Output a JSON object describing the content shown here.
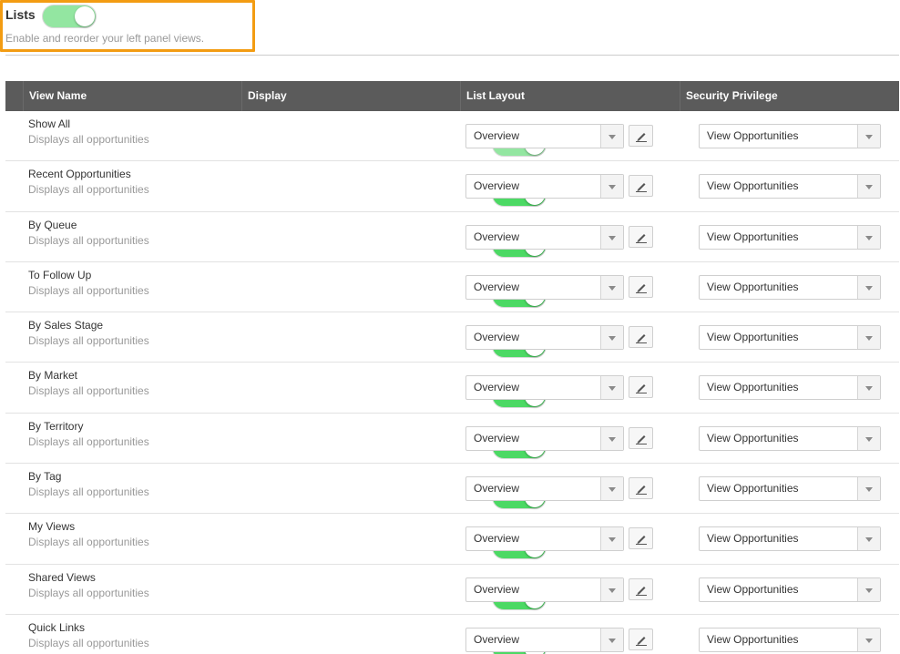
{
  "header": {
    "title": "Lists",
    "subtitle": "Enable and reorder your left panel views."
  },
  "table": {
    "columns": [
      "View Name",
      "Display",
      "List Layout",
      "Security Privilege"
    ],
    "rows": [
      {
        "name": "Show All",
        "desc": "Displays all opportunities",
        "layout": "Overview",
        "privilege": "View Opportunities"
      },
      {
        "name": "Recent Opportunities",
        "desc": "Displays all opportunities",
        "layout": "Overview",
        "privilege": "View Opportunities"
      },
      {
        "name": "By Queue",
        "desc": "Displays all opportunities",
        "layout": "Overview",
        "privilege": "View Opportunities"
      },
      {
        "name": "To Follow Up",
        "desc": "Displays all opportunities",
        "layout": "Overview",
        "privilege": "View Opportunities"
      },
      {
        "name": "By Sales Stage",
        "desc": "Displays all opportunities",
        "layout": "Overview",
        "privilege": "View Opportunities"
      },
      {
        "name": "By Market",
        "desc": "Displays all opportunities",
        "layout": "Overview",
        "privilege": "View Opportunities"
      },
      {
        "name": "By Territory",
        "desc": "Displays all opportunities",
        "layout": "Overview",
        "privilege": "View Opportunities"
      },
      {
        "name": "By Tag",
        "desc": "Displays all opportunities",
        "layout": "Overview",
        "privilege": "View Opportunities"
      },
      {
        "name": "My Views",
        "desc": "Displays all opportunities",
        "layout": "Overview",
        "privilege": "View Opportunities"
      },
      {
        "name": "Shared Views",
        "desc": "Displays all opportunities",
        "layout": "Overview",
        "privilege": "View Opportunities"
      },
      {
        "name": "Quick Links",
        "desc": "Displays all opportunities",
        "layout": "Overview",
        "privilege": "View Opportunities"
      }
    ]
  },
  "colors": {
    "highlight_border": "#f39c12",
    "toggle_on": "#4cd964",
    "toggle_on_light": "#93e6a1",
    "table_header_bg": "#5b5b5b"
  }
}
